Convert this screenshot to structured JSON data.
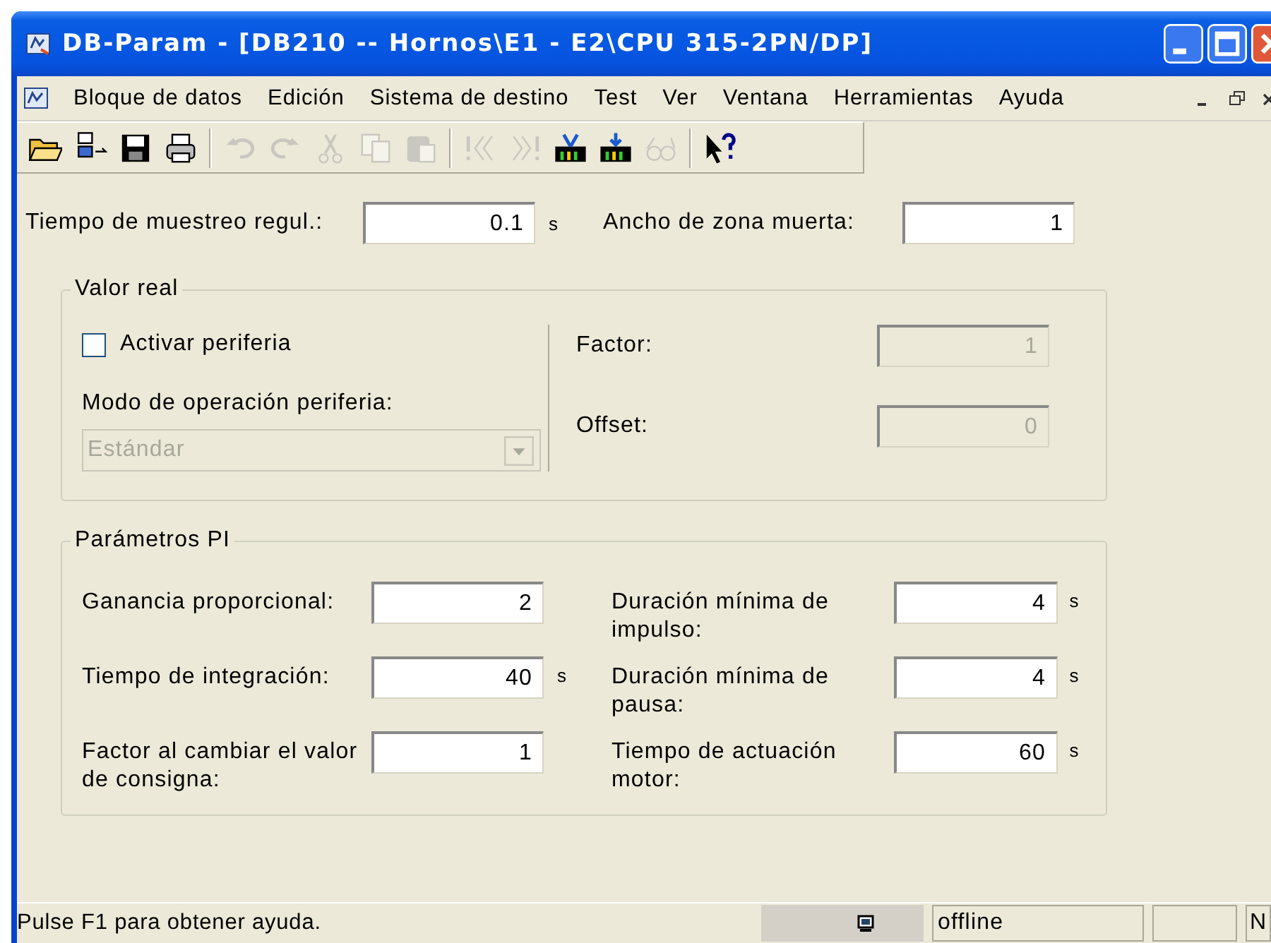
{
  "window": {
    "title": "DB-Param - [DB210 -- Hornos\\E1 - E2\\CPU 315-2PN/DP]"
  },
  "menu": [
    "Bloque de datos",
    "Edición",
    "Sistema de destino",
    "Test",
    "Ver",
    "Ventana",
    "Herramientas",
    "Ayuda"
  ],
  "toolbar": [
    {
      "kind": "open",
      "disabled": false
    },
    {
      "kind": "network",
      "disabled": false
    },
    {
      "kind": "save",
      "disabled": false
    },
    {
      "kind": "print",
      "disabled": false
    },
    {
      "kind": "separator"
    },
    {
      "kind": "undo",
      "disabled": true
    },
    {
      "kind": "redo",
      "disabled": true
    },
    {
      "kind": "cut",
      "disabled": true
    },
    {
      "kind": "copy",
      "disabled": true
    },
    {
      "kind": "paste",
      "disabled": true
    },
    {
      "kind": "separator"
    },
    {
      "kind": "first",
      "disabled": true
    },
    {
      "kind": "last",
      "disabled": true
    },
    {
      "kind": "upload",
      "disabled": false
    },
    {
      "kind": "download",
      "disabled": false
    },
    {
      "kind": "glasses",
      "disabled": true
    },
    {
      "kind": "separator"
    },
    {
      "kind": "help",
      "disabled": false
    }
  ],
  "top_fields": [
    {
      "label": "Tiempo de muestreo regul.:",
      "value": "0.1",
      "unit": "s"
    },
    {
      "label": "Ancho de zona muerta:",
      "value": "1"
    }
  ],
  "valor_real": {
    "title": "Valor real",
    "checkbox": {
      "label": "Activar periferia",
      "checked": false
    },
    "mode_label": "Modo de operación periferia:",
    "mode_dropdown": {
      "value": "Estándar",
      "disabled": true
    },
    "fields": [
      {
        "label": "Factor:",
        "value": "1",
        "disabled": true
      },
      {
        "label": "Offset:",
        "value": "0",
        "disabled": true
      }
    ]
  },
  "parametros_pi": {
    "title": "Parámetros PI",
    "left": [
      {
        "label": "Ganancia proporcional:",
        "value": "2"
      },
      {
        "label": "Tiempo de integración:",
        "value": "40",
        "unit": "s"
      },
      {
        "label": "Factor al cambiar el valor de consigna:",
        "value": "1"
      }
    ],
    "right": [
      {
        "label": "Duración mínima de impulso:",
        "value": "4",
        "unit": "s"
      },
      {
        "label": "Duración mínima de pausa:",
        "value": "4",
        "unit": "s"
      },
      {
        "label": "Tiempo de actuación motor:",
        "value": "60",
        "unit": "s"
      }
    ]
  },
  "status_bar": {
    "text": "Pulse F1 para obtener ayuda.",
    "mode": "offline",
    "indicator": "N"
  }
}
